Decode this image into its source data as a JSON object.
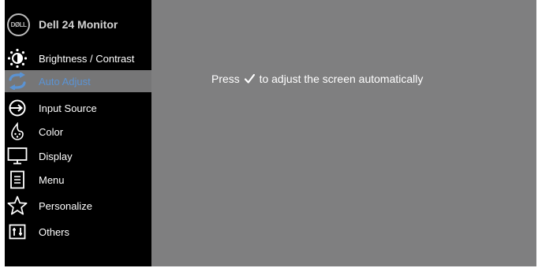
{
  "header": {
    "logo_text": "DØLL",
    "model_name": "Dell 24 Monitor"
  },
  "menu": {
    "items": [
      {
        "label": "Brightness / Contrast",
        "icon": "brightness-icon"
      },
      {
        "label": "Auto Adjust",
        "icon": "auto-adjust-icon",
        "active": true
      },
      {
        "label": "Input Source",
        "icon": "input-source-icon"
      },
      {
        "label": "Color",
        "icon": "color-icon"
      },
      {
        "label": "Display",
        "icon": "display-icon"
      },
      {
        "label": "Menu",
        "icon": "menu-icon"
      },
      {
        "label": "Personalize",
        "icon": "star-icon"
      },
      {
        "label": "Others",
        "icon": "others-icon"
      }
    ]
  },
  "content": {
    "message_prefix": "Press",
    "message_icon": "check-icon",
    "message_suffix": "to adjust the screen automatically"
  },
  "colors": {
    "sidebar_bg": "#000000",
    "content_bg": "#7f7f80",
    "active_bg": "#767677",
    "active_text": "#5b93d3",
    "text": "#ffffff"
  }
}
